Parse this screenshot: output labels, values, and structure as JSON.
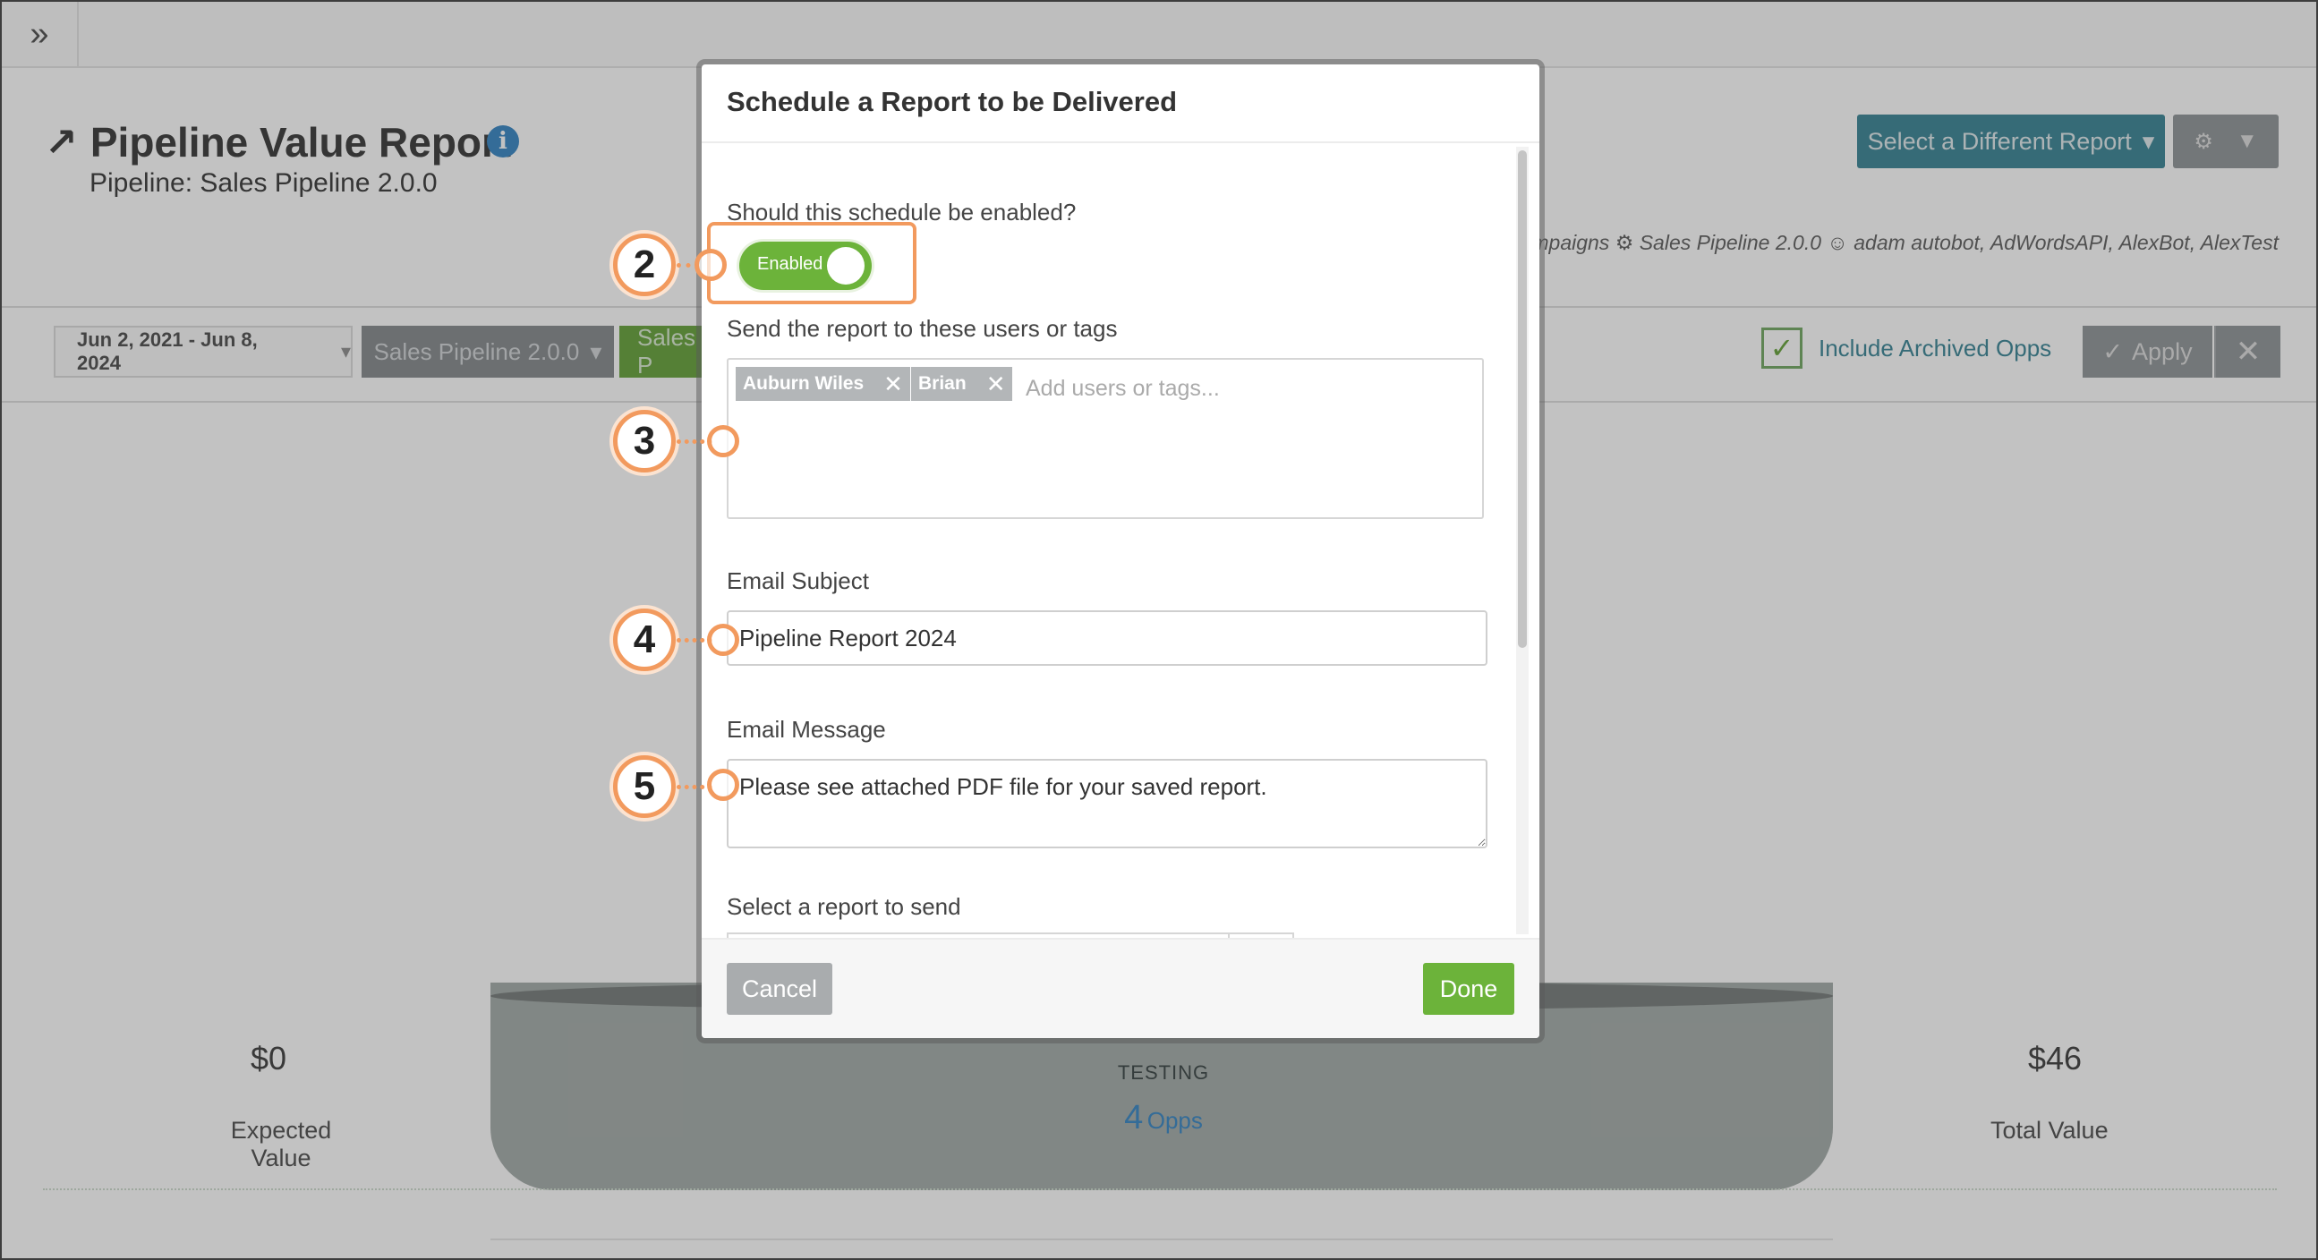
{
  "report": {
    "title": "Pipeline Value Report",
    "subtitle": "Pipeline: Sales Pipeline 2.0.0",
    "select_different_label": "Select a Different Report",
    "meta_line": "ive Campaigns ⚙ Sales Pipeline 2.0.0 ☺ adam autobot, AdWordsAPI, AlexBot, AlexTest"
  },
  "filters": {
    "date_range": "Jun 2, 2021 - Jun 8, 2024",
    "pipeline": "Sales Pipeline 2.0.0",
    "sales_partial": "Sales P",
    "include_archived": "Include Archived Opps",
    "apply_label": "Apply"
  },
  "summary": {
    "expected_value": "$0",
    "expected_label": "Expected Value",
    "total_value": "$46",
    "total_label": "Total Value",
    "stage_name": "TESTING",
    "stage_count": "4",
    "stage_unit": "Opps"
  },
  "modal": {
    "title": "Schedule a Report to be Delivered",
    "enabled_question": "Should this schedule be enabled?",
    "toggle_label": "Enabled",
    "recipients_label": "Send the report to these users or tags",
    "recipients": [
      "Auburn Wiles",
      "Brian"
    ],
    "recipients_placeholder": "Add users or tags...",
    "subject_label": "Email Subject",
    "subject_value": "Pipeline Report 2024",
    "message_label": "Email Message",
    "message_value": "Please see attached PDF file for your saved report.",
    "select_report_label": "Select a report to send",
    "cancel_label": "Cancel",
    "done_label": "Done"
  },
  "callouts": [
    "2",
    "3",
    "4",
    "5"
  ],
  "colors": {
    "accent_orange": "#f29a5e",
    "enabled_green": "#6cb33a",
    "teal_button": "#2f7e8f",
    "link_blue": "#2c7fc0"
  }
}
